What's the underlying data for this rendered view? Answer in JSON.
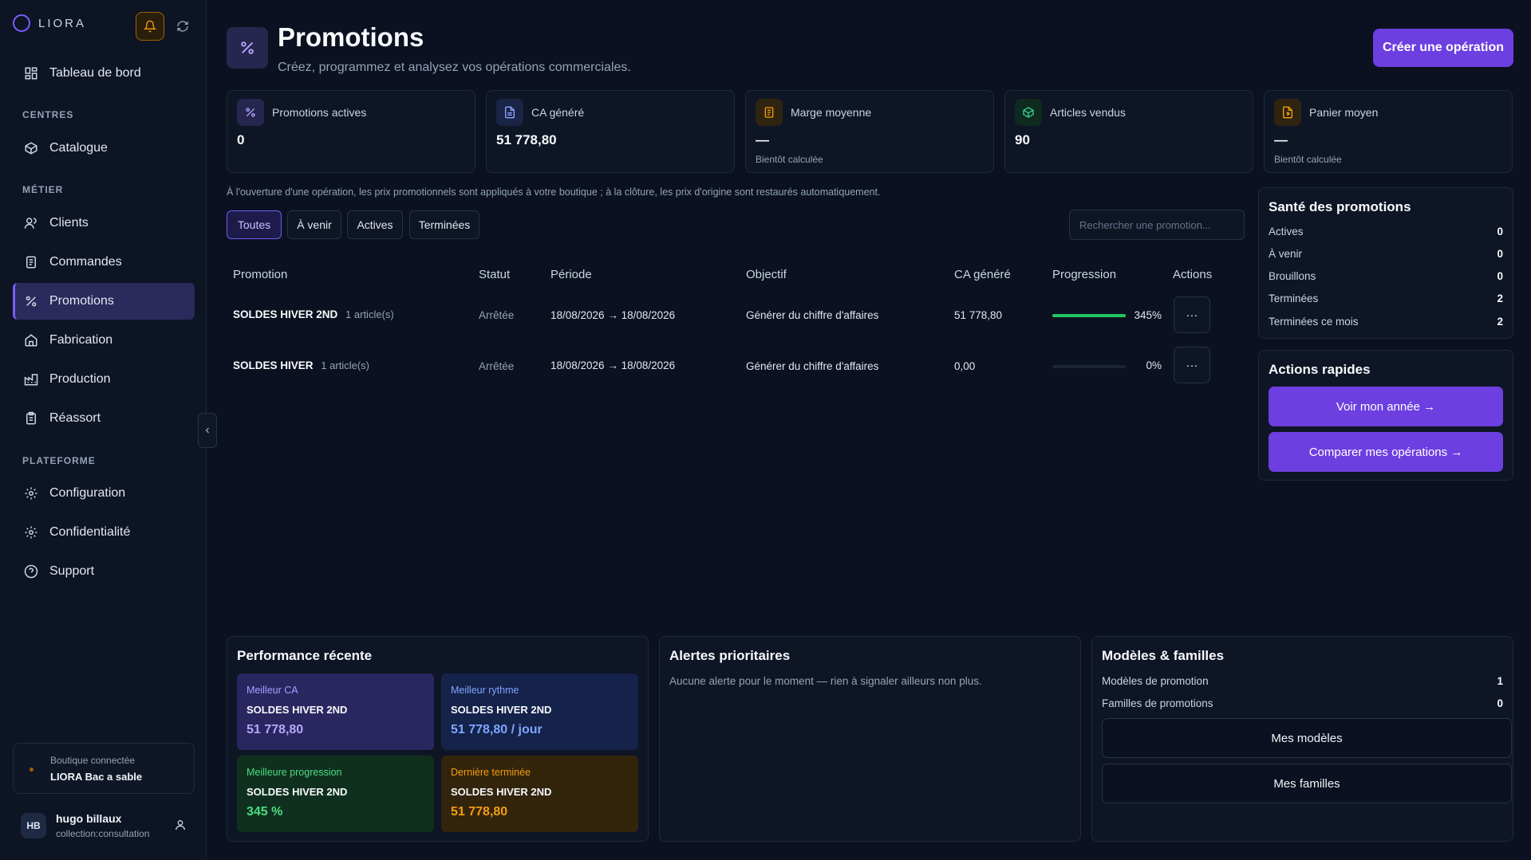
{
  "brand": {
    "name": "LIORA"
  },
  "sidebar": {
    "sections": {
      "centres": "CENTRES",
      "metier": "MÉTIER",
      "plateforme": "PLATEFORME"
    },
    "items": {
      "dashboard": "Tableau de bord",
      "catalogue": "Catalogue",
      "clients": "Clients",
      "commandes": "Commandes",
      "promotions": "Promotions",
      "fabrication": "Fabrication",
      "production": "Production",
      "reassort": "Réassort",
      "configuration": "Configuration",
      "confidentialite": "Confidentialité",
      "support": "Support"
    },
    "shop": {
      "label": "Boutique connectée",
      "name": "LIORA Bac a sable"
    },
    "user": {
      "initials": "HB",
      "name": "hugo billaux",
      "role": "collection:consultation"
    }
  },
  "header": {
    "title": "Promotions",
    "subtitle": "Créez, programmez et analysez vos opérations commerciales.",
    "create_label": "Créer une opération"
  },
  "kpis": [
    {
      "label": "Promotions actives",
      "value": "0",
      "note": ""
    },
    {
      "label": "CA généré",
      "value": "51 778,80",
      "note": ""
    },
    {
      "label": "Marge moyenne",
      "value": "—",
      "note": "Bientôt calculée"
    },
    {
      "label": "Articles vendus",
      "value": "90",
      "note": ""
    },
    {
      "label": "Panier moyen",
      "value": "—",
      "note": "Bientôt calculée"
    }
  ],
  "info": "À l'ouverture d'une opération, les prix promotionnels sont appliqués à votre boutique ; à la clôture, les prix d'origine sont restaurés automatiquement.",
  "filters": {
    "all": "Toutes",
    "upcoming": "À venir",
    "active": "Actives",
    "ended": "Terminées"
  },
  "search": {
    "placeholder": "Rechercher une promotion..."
  },
  "table": {
    "headers": {
      "promotion": "Promotion",
      "status": "Statut",
      "period": "Période",
      "objective": "Objectif",
      "revenue": "CA généré",
      "progress": "Progression",
      "actions": "Actions"
    },
    "rows": [
      {
        "name": "SOLDES HIVER 2ND",
        "count": "1 article(s)",
        "status": "Arrêtée",
        "period": "18/08/2026 → 18/08/2026",
        "objective": "Générer du chiffre d'affaires",
        "revenue": "51 778,80",
        "progress_label": "345%",
        "progress": 1.0,
        "more": "···"
      },
      {
        "name": "SOLDES HIVER",
        "count": "1 article(s)",
        "status": "Arrêtée",
        "period": "18/08/2026 → 18/08/2026",
        "objective": "Générer du chiffre d'affaires",
        "revenue": "0,00",
        "progress_label": "0%",
        "progress": 0.0,
        "more": "···"
      }
    ]
  },
  "health": {
    "title": "Santé des promotions",
    "rows": [
      {
        "label": "Actives",
        "value": "0"
      },
      {
        "label": "À venir",
        "value": "0"
      },
      {
        "label": "Brouillons",
        "value": "0"
      },
      {
        "label": "Terminées",
        "value": "2"
      },
      {
        "label": "Terminées ce mois",
        "value": "2"
      }
    ]
  },
  "quick": {
    "title": "Actions rapides",
    "year": "Voir mon année →",
    "compare": "Comparer mes opérations →"
  },
  "performance": {
    "title": "Performance récente",
    "tiles": [
      {
        "label": "Meilleur CA",
        "name": "SOLDES HIVER 2ND",
        "value": "51 778,80"
      },
      {
        "label": "Meilleur rythme",
        "name": "SOLDES HIVER 2ND",
        "value": "51 778,80 / jour"
      },
      {
        "label": "Meilleure progression",
        "name": "SOLDES HIVER 2ND",
        "value": "345 %"
      },
      {
        "label": "Dernière terminée",
        "name": "SOLDES HIVER 2ND",
        "value": "51 778,80"
      }
    ]
  },
  "alerts": {
    "title": "Alertes prioritaires",
    "text": "Aucune alerte pour le moment — rien à signaler ailleurs non plus."
  },
  "models": {
    "title": "Modèles & familles",
    "rows": [
      {
        "label": "Modèles de promotion",
        "value": "1"
      },
      {
        "label": "Familles de promotions",
        "value": "0"
      }
    ],
    "models_btn": "Mes modèles",
    "families_btn": "Mes familles"
  },
  "colors": {
    "accent": "#6d3fe0",
    "success": "#22c55e",
    "background": "#0b1120"
  }
}
